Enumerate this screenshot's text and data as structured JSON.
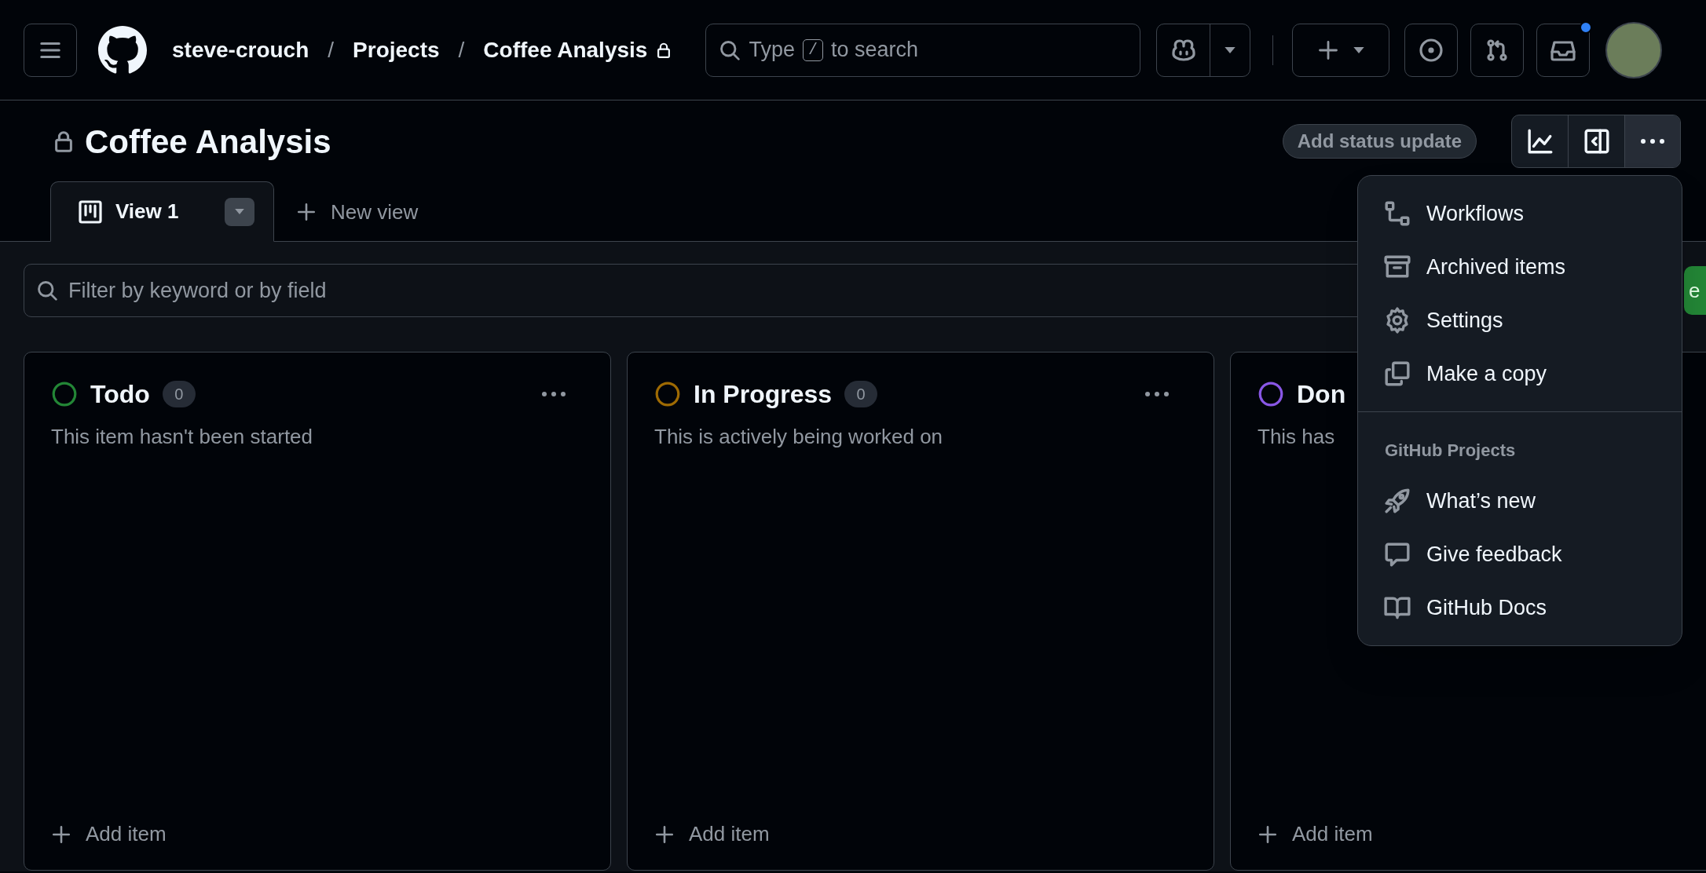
{
  "header": {
    "breadcrumbs": [
      {
        "label": "steve-crouch",
        "private": false
      },
      {
        "separator": "/",
        "label": "Projects",
        "private": false
      },
      {
        "separator": "/",
        "label": "Coffee Analysis",
        "private": true
      }
    ],
    "search": {
      "before_key": "Type",
      "key": "/",
      "after_key": "to search"
    },
    "inbox_unread": true
  },
  "project": {
    "title": "Coffee Analysis",
    "private": true,
    "status_button": "Add status update"
  },
  "tabs": [
    {
      "label": "View 1",
      "selected": true
    }
  ],
  "new_view_button": "New view",
  "filter": {
    "placeholder": "Filter by keyword or by field"
  },
  "save_button": "e",
  "columns": [
    {
      "title": "Todo",
      "count": "0",
      "description": "This item hasn't been started",
      "color": "#238636",
      "add_label": "Add item"
    },
    {
      "title": "In Progress",
      "count": "0",
      "description": "This is actively being worked on",
      "color": "#9e6a03",
      "add_label": "Add item"
    },
    {
      "title": "Don",
      "description": "This has",
      "color": "#8957e5",
      "add_label": "Add item"
    }
  ],
  "menu": {
    "groups": [
      {
        "items": [
          {
            "label": "Workflows",
            "kind": "workflows"
          },
          {
            "label": "Archived items",
            "kind": "archive"
          },
          {
            "label": "Settings",
            "kind": "settings"
          },
          {
            "label": "Make a copy",
            "kind": "copy"
          }
        ]
      },
      {
        "heading": "GitHub Projects",
        "items": [
          {
            "label": "What’s new",
            "kind": "rocket"
          },
          {
            "label": "Give feedback",
            "kind": "feedback"
          },
          {
            "label": "GitHub Docs",
            "kind": "docs"
          }
        ]
      }
    ]
  }
}
